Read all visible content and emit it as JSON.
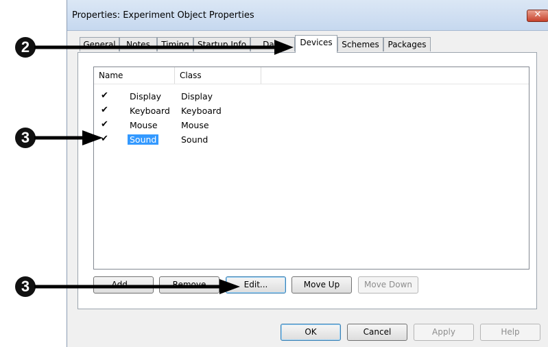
{
  "window": {
    "title": "Properties: Experiment Object Properties",
    "close_glyph": "✕"
  },
  "tabs": [
    {
      "label": "General"
    },
    {
      "label": "Notes"
    },
    {
      "label": "Timing"
    },
    {
      "label": "Startup Info"
    },
    {
      "label": "Data"
    },
    {
      "label": "Devices",
      "active": true
    },
    {
      "label": "Schemes"
    },
    {
      "label": "Packages"
    }
  ],
  "devices_list": {
    "columns": [
      "Name",
      "Class"
    ],
    "rows": [
      {
        "checked": true,
        "name": "Display",
        "class": "Display"
      },
      {
        "checked": true,
        "name": "Keyboard",
        "class": "Keyboard"
      },
      {
        "checked": true,
        "name": "Mouse",
        "class": "Mouse"
      },
      {
        "checked": true,
        "name": "Sound",
        "class": "Sound",
        "selected": true
      }
    ]
  },
  "list_buttons": {
    "add": "Add...",
    "remove": "Remove",
    "edit": "Edit...",
    "move_up": "Move Up",
    "move_down": "Move Down"
  },
  "dialog_buttons": {
    "ok": "OK",
    "cancel": "Cancel",
    "apply": "Apply",
    "help": "Help"
  },
  "annotations": [
    {
      "number": "2",
      "target": "Devices tab"
    },
    {
      "number": "3",
      "target": "Sound checkbox"
    },
    {
      "number": "3",
      "target": "Edit button"
    }
  ],
  "check_glyph": "✔",
  "colors": {
    "selection": "#3399ff",
    "arrow": "#000000"
  }
}
